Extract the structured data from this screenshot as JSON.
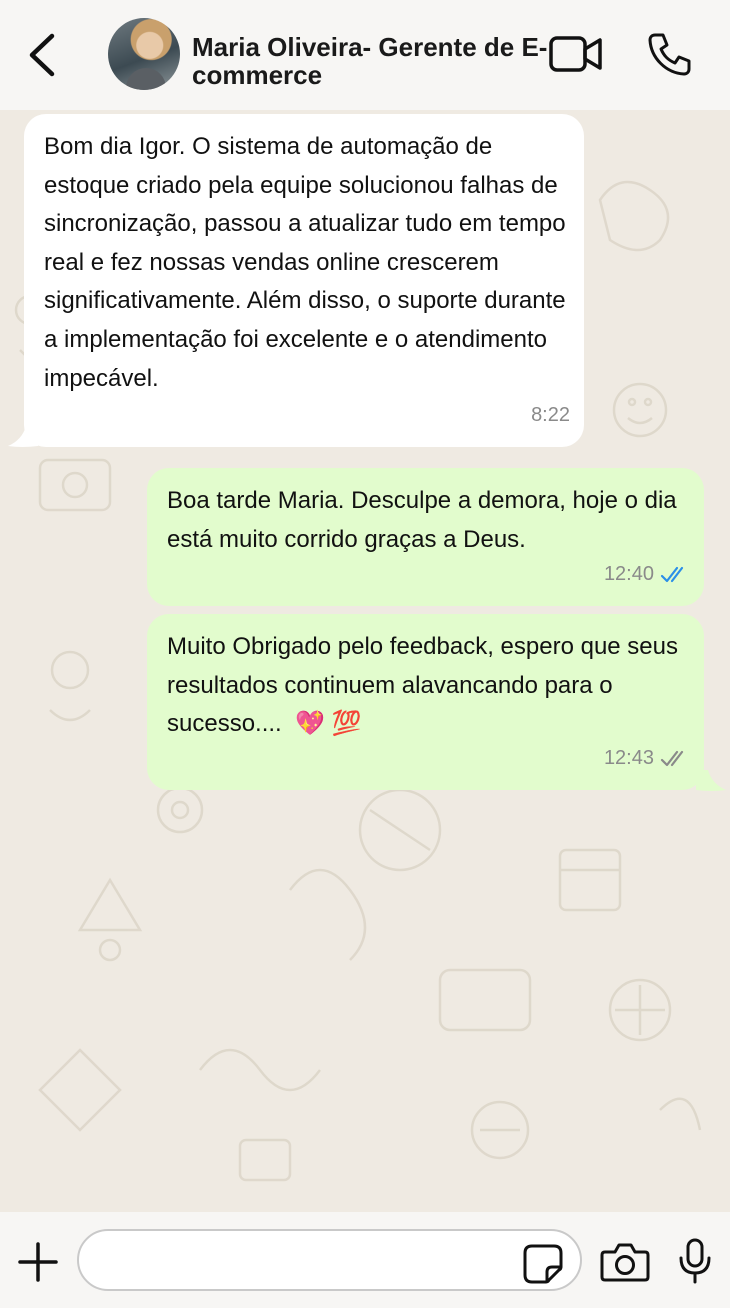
{
  "header": {
    "contact_name": "Maria Oliveira- Gerente de E-commerce",
    "icons": [
      "back-icon",
      "video-call-icon",
      "phone-icon"
    ]
  },
  "messages": [
    {
      "direction": "incoming",
      "text": "Bom dia Igor. O sistema de automação de estoque criado pela equipe solucionou falhas de sincronização, passou a atualizar tudo em tempo real e fez nossas vendas online crescerem significativamente. Além disso, o suporte durante a implementação foi excelente e o atendimento impecável.",
      "time": "8:22"
    },
    {
      "direction": "outgoing",
      "text": "Boa tarde Maria. Desculpe a demora, hoje o dia está muito corrido graças a Deus.",
      "time": "12:40",
      "status": "read"
    },
    {
      "direction": "outgoing",
      "text": "Muito Obrigado pelo feedback, espero que seus resultados continuem alavancando para o sucesso....",
      "emojis": "💖 💯",
      "time": "12:43",
      "status": "delivered"
    }
  ],
  "composer": {
    "value": "",
    "placeholder": "",
    "icons": [
      "plus-icon",
      "sticker-icon",
      "camera-icon",
      "mic-icon"
    ]
  },
  "colors": {
    "incoming_bubble": "#ffffff",
    "outgoing_bubble": "#e2fccd",
    "chat_background": "#efeae2",
    "read_ticks": "#2b8fe8",
    "delivered_ticks": "#8a8a8a"
  }
}
